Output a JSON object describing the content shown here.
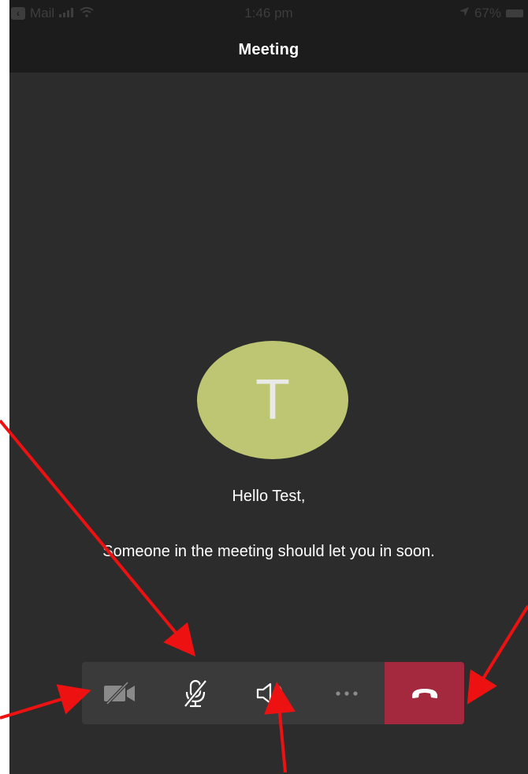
{
  "status_bar": {
    "back_app": "Mail",
    "time": "1:46 pm",
    "battery": "67%"
  },
  "header": {
    "title": "Meeting"
  },
  "participant": {
    "initial": "T"
  },
  "messages": {
    "greeting": "Hello Test,",
    "waiting": "Someone in the meeting should let you in soon."
  },
  "controls": {
    "items": [
      {
        "icon": "camera-off-icon"
      },
      {
        "icon": "mic-off-icon"
      },
      {
        "icon": "speaker-icon"
      },
      {
        "icon": "more-icon"
      },
      {
        "icon": "hang-up-icon"
      }
    ]
  },
  "colors": {
    "background": "#2c2c2c",
    "bars": "#1c1c1c",
    "avatar": "#bec673",
    "end_call": "#a4293f",
    "annotation_arrows": "#ee1111"
  }
}
